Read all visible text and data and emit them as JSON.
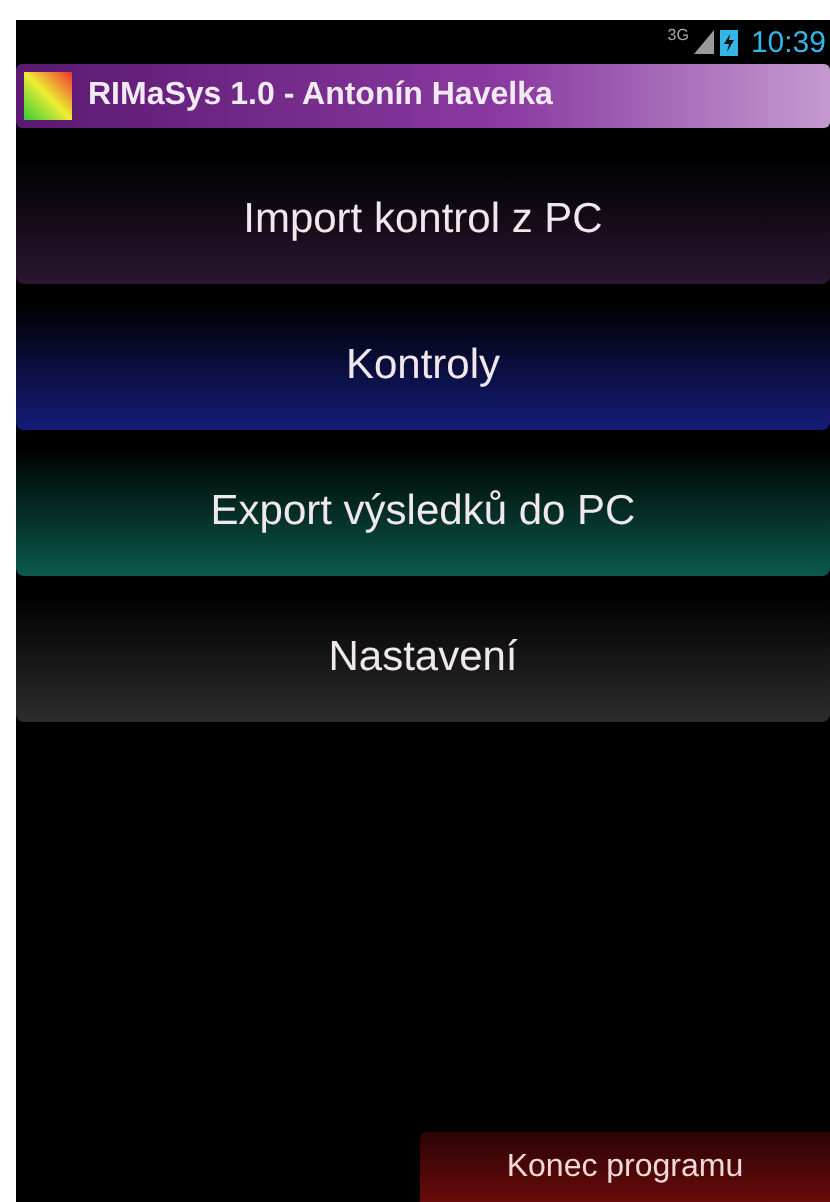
{
  "status_bar": {
    "network": "3G",
    "time": "10:39"
  },
  "title_bar": {
    "title": "RIMaSys 1.0 - Antonín Havelka"
  },
  "menu": [
    {
      "label": "Import kontrol z PC",
      "color": "#2a1630"
    },
    {
      "label": "Kontroly",
      "color": "#141c78"
    },
    {
      "label": "Export výsledků do PC",
      "color": "#0b5a4c"
    },
    {
      "label": "Nastavení",
      "color": "#2c2c2c"
    }
  ],
  "exit_button": {
    "label": "Konec programu"
  }
}
